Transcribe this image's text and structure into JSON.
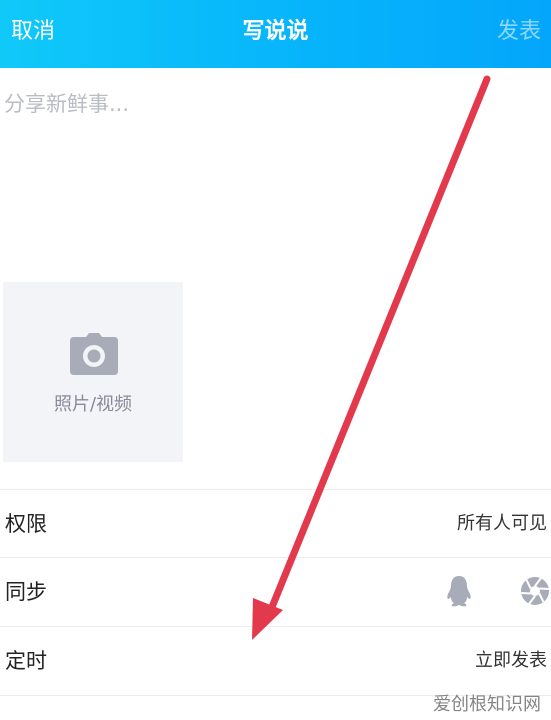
{
  "header": {
    "cancel_label": "取消",
    "title": "写说说",
    "publish_label": "发表"
  },
  "compose": {
    "placeholder": "分享新鲜事..."
  },
  "media": {
    "icon": "camera-icon",
    "label": "照片/视频"
  },
  "settings": {
    "permission": {
      "label": "权限",
      "value": "所有人可见"
    },
    "sync": {
      "label": "同步",
      "icons": [
        "qq-penguin-icon",
        "aperture-icon"
      ]
    },
    "schedule": {
      "label": "定时",
      "value": "立即发表"
    }
  },
  "watermark": {
    "text": "爱创根知识网"
  },
  "colors": {
    "header_start": "#10c9f9",
    "header_end": "#04a6fb",
    "arrow": "#e23a4c",
    "placeholder": "#b9bcc3",
    "tile_bg": "#f3f4f8",
    "icon_gray": "#a7acb8"
  }
}
